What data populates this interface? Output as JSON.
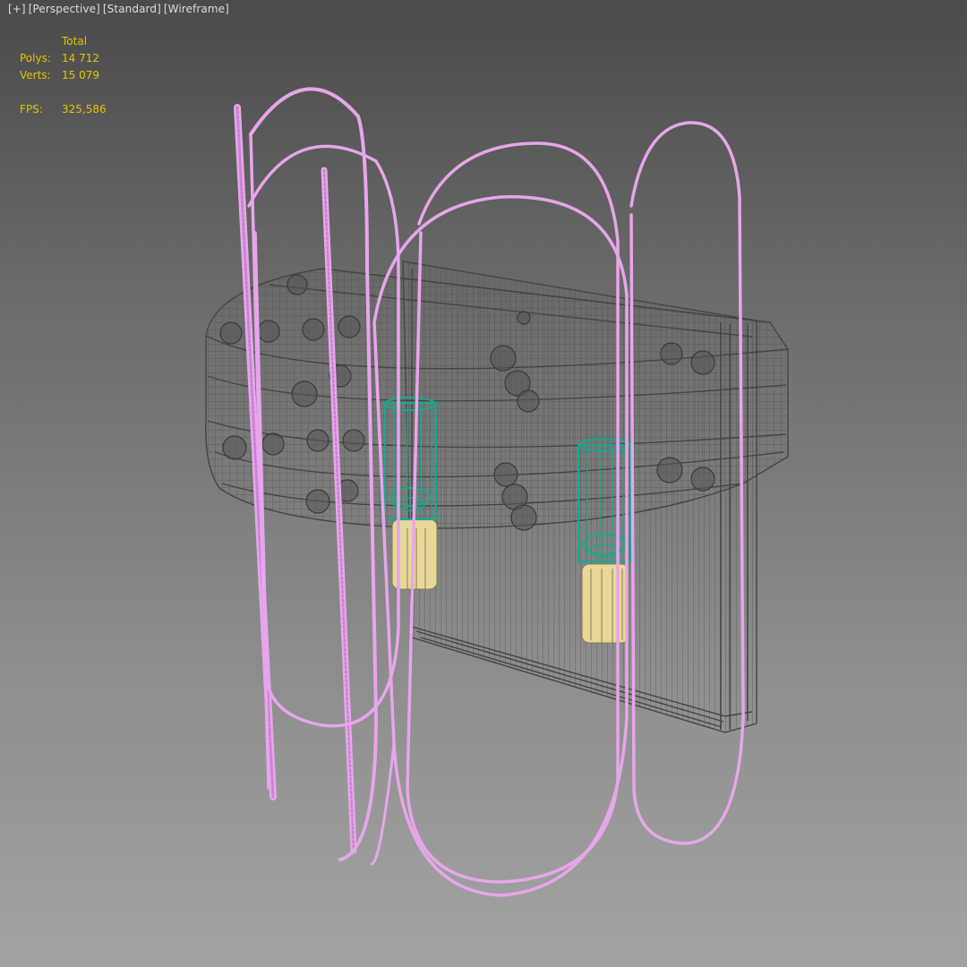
{
  "viewport": {
    "menu_plus": "[+]",
    "view_mode": "[Perspective]",
    "shading_preset": "[Standard]",
    "display_style": "[Wireframe]"
  },
  "stats": {
    "header": "Total",
    "polys_label": "Polys:",
    "polys_value": "14 712",
    "verts_label": "Verts:",
    "verts_value": "15 079",
    "fps_label": "FPS:",
    "fps_value": "325,586"
  },
  "colors": {
    "background_top": "#4b4b4b",
    "background_bottom": "#a3a3a3",
    "stats_text": "#e6c200",
    "wire_pink": "#e6a6ea",
    "wire_dark": "#454545",
    "wire_teal": "#19a88f",
    "shade_tan": "#e7d89a"
  }
}
